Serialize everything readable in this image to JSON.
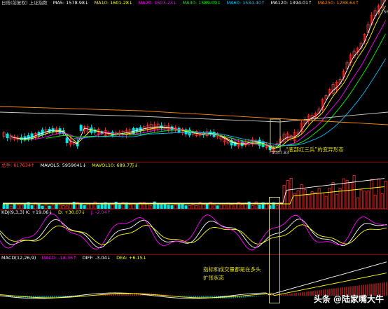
{
  "price_panel": {
    "title": "日线(前复权)  上证指数",
    "ma_items": [
      {
        "label": "MA5: 1578.98↓",
        "color": "#ffffff"
      },
      {
        "label": "MA10: 1601.28↓",
        "color": "#ffff00"
      },
      {
        "label": "MA20: 1603.23↓",
        "color": "#ff00ff"
      },
      {
        "label": "MA30: 1589.09↓",
        "color": "#00ff00"
      },
      {
        "label": "MA60: 1584.40↑",
        "color": "#00bfff"
      },
      {
        "label": "MA120: 1394.01↑",
        "color": "#ffffff"
      },
      {
        "label": "MA250: 1288.64↑",
        "color": "#ff8c00"
      }
    ],
    "high_label": "1756",
    "low_label": "1047.83",
    "annotation": "“底部红三兵”的变异形态"
  },
  "volume_panel": {
    "items": [
      {
        "label": "总手: 617634↑",
        "color": "#ff4040"
      },
      {
        "label": "MAVOL5: 5959041↓",
        "color": "#ffffff"
      },
      {
        "label": "MAVOL10: 689.7万↓",
        "color": "#ffff00"
      }
    ]
  },
  "kdj_panel": {
    "items": [
      {
        "label": "KDJ(9,3,3) K: +19.06↓",
        "color": "#ffffff"
      },
      {
        "label": "D: +30.07↓",
        "color": "#ffff00"
      },
      {
        "label": "J: -2.04↑",
        "color": "#ff00ff"
      }
    ]
  },
  "macd_panel": {
    "items": [
      {
        "label": "MACD(12,26,9)",
        "color": "#ffffff"
      },
      {
        "label": "MACD: -18.36↑",
        "color": "#ff00ff"
      },
      {
        "label": "DIFF: -3.04↓",
        "color": "#ffffff"
      },
      {
        "label": "DEA: +6.15↓",
        "color": "#ffff00"
      }
    ],
    "annotation_line1": "指标和成交量都是在多头",
    "annotation_line2": "扩张状态"
  },
  "watermark": "头条 @陆家嘴大牛"
}
